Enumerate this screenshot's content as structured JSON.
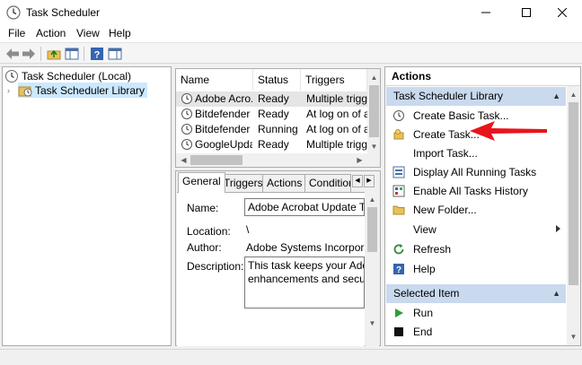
{
  "window": {
    "title": "Task Scheduler",
    "controls": {
      "minimize": "minimize",
      "maximize": "maximize",
      "close": "close"
    }
  },
  "menu": [
    "File",
    "Action",
    "View",
    "Help"
  ],
  "toolbar": {
    "buttons": [
      "back-arrow-icon",
      "forward-arrow-icon",
      "folder-up-icon",
      "show-hide-console-tree-icon",
      "help-icon",
      "show-action-pane-icon"
    ]
  },
  "tree": {
    "root": "Task Scheduler (Local)",
    "library": "Task Scheduler Library"
  },
  "task_list": {
    "columns": [
      "Name",
      "Status",
      "Triggers"
    ],
    "rows": [
      {
        "name": "Adobe Acro...",
        "status": "Ready",
        "triggers": "Multiple triggers"
      },
      {
        "name": "Bitdefender ...",
        "status": "Ready",
        "triggers": "At log on of any"
      },
      {
        "name": "Bitdefender ...",
        "status": "Running",
        "triggers": "At log on of any"
      },
      {
        "name": "GoogleUpda...",
        "status": "Ready",
        "triggers": "Multiple triggers"
      }
    ]
  },
  "detail": {
    "tabs": [
      "General",
      "Triggers",
      "Actions",
      "Condition"
    ],
    "name_label": "Name:",
    "name_value": "Adobe Acrobat Update Task",
    "location_label": "Location:",
    "location_value": "\\",
    "author_label": "Author:",
    "author_value": "Adobe Systems Incorporated",
    "description_label": "Description:",
    "description_line1": "This task keeps your Adobe",
    "description_line2": "enhancements and security"
  },
  "actions": {
    "title": "Actions",
    "section_library": "Task Scheduler Library",
    "items": [
      "Create Basic Task...",
      "Create Task...",
      "Import Task...",
      "Display All Running Tasks",
      "Enable All Tasks History",
      "New Folder...",
      "View",
      "Refresh",
      "Help"
    ],
    "section_selected": "Selected Item",
    "selected_items": [
      "Run",
      "End"
    ]
  },
  "colors": {
    "section_header": "#c9d9ee",
    "selected_tree": "#cce8ff",
    "annotation_arrow": "#e8141c"
  }
}
